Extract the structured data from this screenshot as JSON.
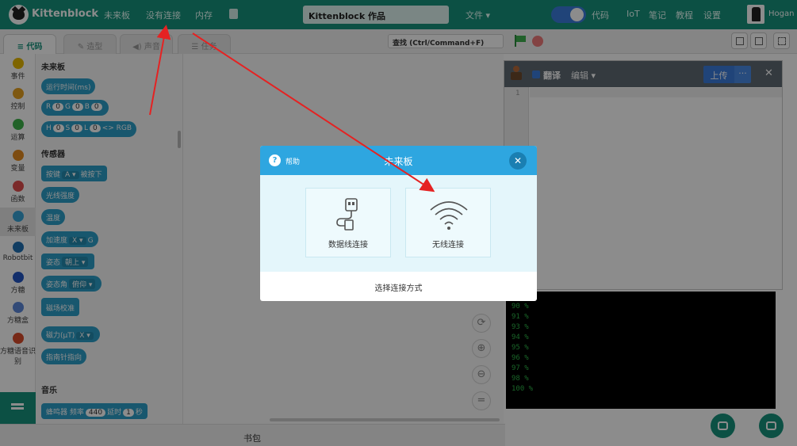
{
  "topbar": {
    "brand": "Kittenblock",
    "nav": [
      "未来板",
      "没有连接",
      "内存"
    ],
    "project_name": "Kittenblock 作品",
    "file_menu": "文件 ▾",
    "code_toggle_label": "代码",
    "links": [
      "IoT",
      "笔记",
      "教程",
      "设置"
    ],
    "username": "Hogan"
  },
  "tabs": [
    {
      "label": "≡ 代码",
      "active": true
    },
    {
      "label": "✎ 造型",
      "active": false
    },
    {
      "label": "◀) 声音",
      "active": false
    },
    {
      "label": "☰ 任务",
      "active": false
    }
  ],
  "toolbar": {
    "find_placeholder": "查找 (Ctrl/Command+F)"
  },
  "categories": [
    {
      "label": "事件",
      "color": "#e6b800"
    },
    {
      "label": "控制",
      "color": "#e6a020"
    },
    {
      "label": "运算",
      "color": "#3cb34a"
    },
    {
      "label": "变量",
      "color": "#e38b1f"
    },
    {
      "label": "函数",
      "color": "#e04e4e"
    },
    {
      "label": "未来板",
      "color": "#37a3d6"
    },
    {
      "label": "Robotbit",
      "color": "#1f6fb3"
    },
    {
      "label": "方糖",
      "color": "#2255c4"
    },
    {
      "label": "方糖盒",
      "color": "#5b88d9"
    },
    {
      "label": "方糖语音识别",
      "color": "#d94b2b"
    }
  ],
  "palette": {
    "section_board": "未来板",
    "runtime": "运行时间(ms)",
    "rgb": {
      "r": "R",
      "g": "G",
      "b": "B",
      "v": "0"
    },
    "hsl": {
      "h": "H",
      "s": "S",
      "l": "L",
      "v": "0",
      "suffix": "<> RGB"
    },
    "section_sensor": "传感器",
    "button": {
      "text": "按键",
      "key": "A ▾",
      "state": "被按下"
    },
    "light": "光线强度",
    "temp": "温度",
    "accel": {
      "text": "加速度",
      "axis": "X ▾",
      "unit": "G"
    },
    "posture": {
      "text": "姿态",
      "value": "朝上 ▾"
    },
    "attitude": {
      "text": "姿态角",
      "value": "俯仰 ▾"
    },
    "mag_calib": "磁场校准",
    "mag": {
      "text": "磁力(μT)",
      "axis": "X ▾"
    },
    "compass": "指南针指向",
    "section_music": "音乐",
    "buzzer": {
      "text": "蜂鸣器 频率",
      "freq": "440",
      "delay": "延时",
      "beats": "1",
      "unit": "秒"
    }
  },
  "zoom_buttons": [
    "⟳",
    "⊕",
    "⊖",
    "="
  ],
  "code_panel": {
    "translate_label": "翻译",
    "edit_label": "编辑 ▾",
    "upload_label": "上传",
    "more_label": "···",
    "close_label": "✕",
    "line_number": "1"
  },
  "console": [
    "90 %",
    "91 %",
    "93 %",
    "94 %",
    "95 %",
    "96 %",
    "97 %",
    "98 %",
    "100 %"
  ],
  "bottombar": {
    "backpack": "书包"
  },
  "modal": {
    "help": "帮助",
    "title": "未来板",
    "close": "✕",
    "options": [
      "数据线连接",
      "无线连接"
    ],
    "footer": "选择连接方式"
  }
}
